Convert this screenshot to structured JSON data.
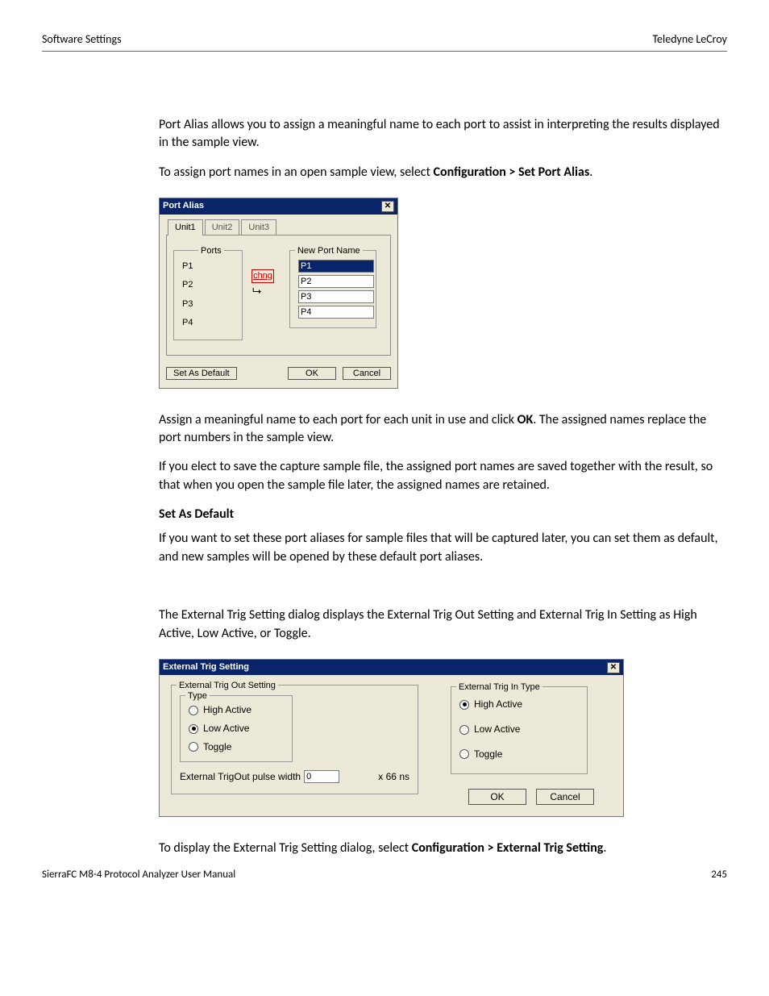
{
  "header": {
    "left": "Software Settings",
    "right": "Teledyne LeCroy"
  },
  "para1": "Port Alias allows you to assign a meaningful name to each port to assist in interpreting the results displayed in the sample view.",
  "para2_a": "To assign port names in an open sample view, select ",
  "para2_b": "Configuration > Set Port Alias",
  "para2_c": ".",
  "portAliasDlg": {
    "title": "Port Alias",
    "tabs": [
      "Unit1",
      "Unit2",
      "Unit3"
    ],
    "portsLabel": "Ports",
    "ports": [
      "P1",
      "P2",
      "P3",
      "P4"
    ],
    "chng": "chng",
    "newNameLabel": "New Port Name",
    "newNames": [
      "P1",
      "P2",
      "P3",
      "P4"
    ],
    "setDefault": "Set As Default",
    "ok": "OK",
    "cancel": "Cancel"
  },
  "para3_a": "Assign a meaningful name to each port for each unit in use and click ",
  "para3_b": "OK",
  "para3_c": ". The assigned names replace the port numbers in the sample view.",
  "para4": "If you elect to save the capture sample file, the assigned port names are saved together with the result, so that when you open the sample file later, the assigned names are retained.",
  "heading1": "Set As Default",
  "para5": "If you want to set these port aliases for sample files that will be captured later, you can set them as default, and new samples will be opened by these default port aliases.",
  "para6": "The External Trig Setting dialog displays the External Trig Out Setting and External Trig In Setting as High Active, Low Active, or Toggle.",
  "extDlg": {
    "title": "External Trig Setting",
    "outLabel": "External Trig Out Setting",
    "typeLabel": "Type",
    "outOptions": [
      "High Active",
      "Low Active",
      "Toggle"
    ],
    "outSelected": 1,
    "pulseLabel": "External TrigOut pulse width",
    "pulseValue": "0",
    "pulseUnit": "x 66 ns",
    "inLabel": "External Trig In Type",
    "inOptions": [
      "High Active",
      "Low Active",
      "Toggle"
    ],
    "inSelected": 0,
    "ok": "OK",
    "cancel": "Cancel"
  },
  "para7_a": "To display the External Trig Setting dialog, select ",
  "para7_b": "Configuration > External Trig Setting",
  "para7_c": ".",
  "footer": {
    "left": "SierraFC M8-4 Protocol Analyzer User Manual",
    "right": "245"
  }
}
